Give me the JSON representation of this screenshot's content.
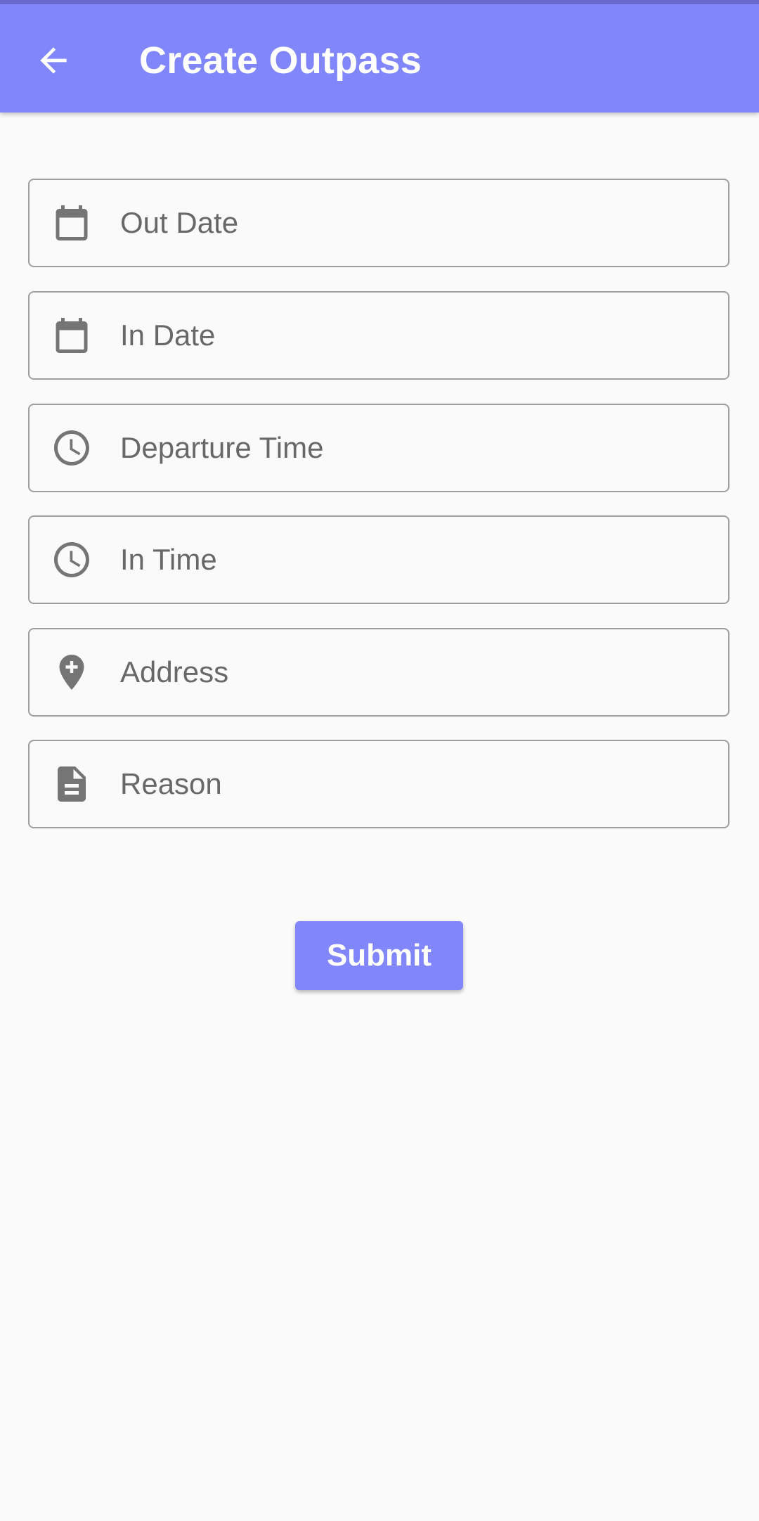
{
  "app_bar": {
    "title": "Create Outpass",
    "back_icon": "arrow-left-icon"
  },
  "form": {
    "fields": [
      {
        "placeholder": "Out Date",
        "value": "",
        "icon": "calendar-icon"
      },
      {
        "placeholder": "In Date",
        "value": "",
        "icon": "calendar-icon"
      },
      {
        "placeholder": "Departure Time",
        "value": "",
        "icon": "clock-icon"
      },
      {
        "placeholder": "In Time",
        "value": "",
        "icon": "clock-icon"
      },
      {
        "placeholder": "Address",
        "value": "",
        "icon": "add-location-icon"
      },
      {
        "placeholder": "Reason",
        "value": "",
        "icon": "document-icon"
      }
    ],
    "submit_label": "Submit"
  },
  "colors": {
    "primary": "#8187fa",
    "status_bar": "#6b6bcf",
    "background": "#fafafa",
    "field_border": "#9e9e9e",
    "icon": "#757575"
  }
}
